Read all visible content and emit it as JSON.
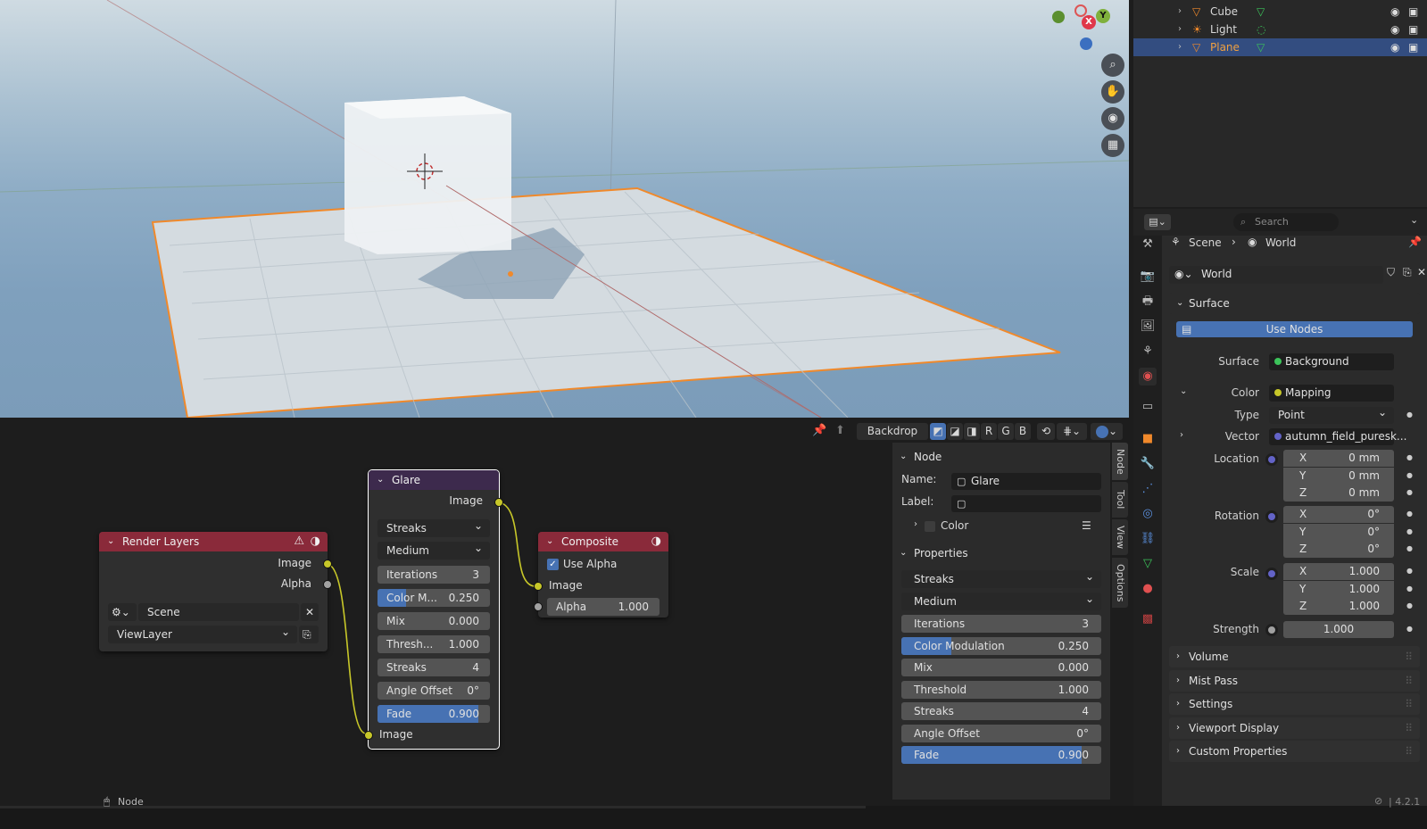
{
  "viewport": {
    "gizmo": {
      "x_label": "X",
      "y_label": "Y"
    },
    "nav_buttons": [
      "zoom-icon",
      "hand-pan-icon",
      "camera-icon",
      "grid-icon"
    ]
  },
  "outliner": {
    "rows": [
      {
        "label": "Cube",
        "icon": "mesh-icon",
        "selected": false
      },
      {
        "label": "Light",
        "icon": "light-icon",
        "selected": false
      },
      {
        "label": "Plane",
        "icon": "mesh-icon",
        "selected": true
      }
    ]
  },
  "node_editor": {
    "header": {
      "backdrop_label": "Backdrop",
      "channels": [
        "R",
        "G",
        "B"
      ]
    },
    "render_layers": {
      "title": "Render Layers",
      "outputs": [
        "Image",
        "Alpha"
      ],
      "scene": "Scene",
      "view_layer": "ViewLayer"
    },
    "glare": {
      "title": "Glare",
      "output": "Image",
      "glare_type": "Streaks",
      "quality": "Medium",
      "fields": [
        {
          "label": "Iterations",
          "value": "3",
          "fill": 0
        },
        {
          "label": "Color M...",
          "value": "0.250",
          "fill": 0.25
        },
        {
          "label": "Mix",
          "value": "0.000",
          "fill": 0
        },
        {
          "label": "Thresh...",
          "value": "1.000",
          "fill": 0
        },
        {
          "label": "Streaks",
          "value": "4",
          "fill": 0
        },
        {
          "label": "Angle Offset",
          "value": "0°",
          "fill": 0
        },
        {
          "label": "Fade",
          "value": "0.900",
          "fill": 0.9
        }
      ],
      "input": "Image"
    },
    "composite": {
      "title": "Composite",
      "use_alpha": "Use Alpha",
      "input": "Image",
      "alpha_label": "Alpha",
      "alpha_value": "1.000"
    },
    "sidebar": {
      "node_header": "Node",
      "name_label": "Name:",
      "name_value": "Glare",
      "label_label": "Label:",
      "label_value": "",
      "color_label": "Color",
      "properties_header": "Properties",
      "glare_type": "Streaks",
      "quality": "Medium",
      "fields": [
        {
          "label": "Iterations",
          "value": "3",
          "fill": 0
        },
        {
          "label": "Color Modulation",
          "value": "0.250",
          "fill": 0.25
        },
        {
          "label": "Mix",
          "value": "0.000",
          "fill": 0
        },
        {
          "label": "Threshold",
          "value": "1.000",
          "fill": 0
        },
        {
          "label": "Streaks",
          "value": "4",
          "fill": 0
        },
        {
          "label": "Angle Offset",
          "value": "0°",
          "fill": 0
        },
        {
          "label": "Fade",
          "value": "0.900",
          "fill": 0.9
        }
      ],
      "tabs": [
        "Node",
        "Tool",
        "View",
        "Options"
      ]
    }
  },
  "properties": {
    "search_placeholder": "Search",
    "breadcrumb": {
      "scene": "Scene",
      "world": "World"
    },
    "world_name": "World",
    "surface_header": "Surface",
    "use_nodes": "Use Nodes",
    "surface_label": "Surface",
    "surface_value": "Background",
    "color_label": "Color",
    "color_value": "Mapping",
    "type_label": "Type",
    "type_value": "Point",
    "vector_label": "Vector",
    "vector_value": "autumn_field_puresk...",
    "location_label": "Location",
    "location": [
      {
        "axis": "X",
        "value": "0 mm"
      },
      {
        "axis": "Y",
        "value": "0 mm"
      },
      {
        "axis": "Z",
        "value": "0 mm"
      }
    ],
    "rotation_label": "Rotation",
    "rotation": [
      {
        "axis": "X",
        "value": "0°"
      },
      {
        "axis": "Y",
        "value": "0°"
      },
      {
        "axis": "Z",
        "value": "0°"
      }
    ],
    "scale_label": "Scale",
    "scale": [
      {
        "axis": "X",
        "value": "1.000"
      },
      {
        "axis": "Y",
        "value": "1.000"
      },
      {
        "axis": "Z",
        "value": "1.000"
      }
    ],
    "strength_label": "Strength",
    "strength_value": "1.000",
    "panels": [
      "Volume",
      "Mist Pass",
      "Settings",
      "Viewport Display",
      "Custom Properties"
    ]
  },
  "statusbar": {
    "mode": "Node",
    "version": "4.2.1"
  },
  "colors": {
    "accent": "#4772b3",
    "render_layers_header": "#8a2a3a",
    "glare_header": "#3d2a4d",
    "composite_header": "#8a2a3a",
    "selection_outline": "#f0892b",
    "socket_yellow": "#c7c729",
    "socket_grey": "#a1a1a1"
  }
}
